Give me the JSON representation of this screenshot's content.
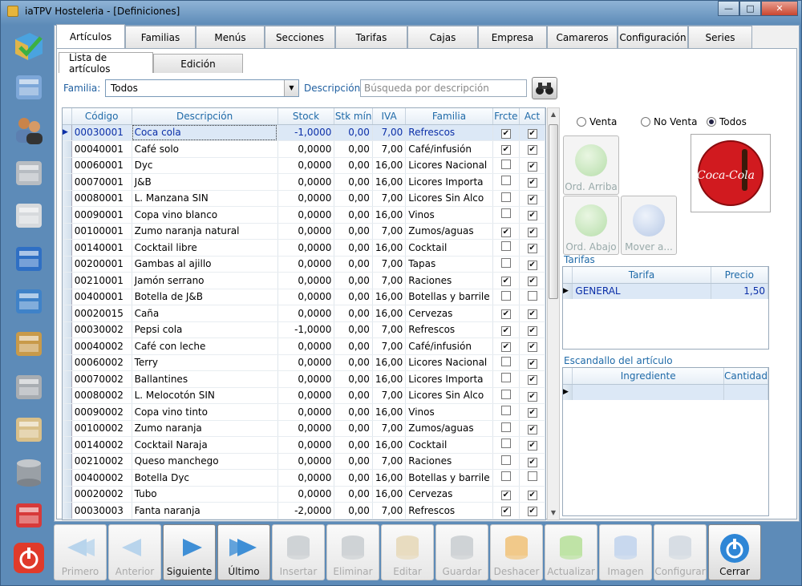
{
  "window": {
    "title": "iaTPV Hosteleria - [Definiciones]",
    "minimize": "—",
    "maximize": "□",
    "close": "✕"
  },
  "sidebar": [
    {
      "name": "sidebar-articulos",
      "icon": "box-check-icon"
    },
    {
      "name": "sidebar-ventas",
      "icon": "window-grid-icon"
    },
    {
      "name": "sidebar-usuarios",
      "icon": "users-icon"
    },
    {
      "name": "sidebar-caja",
      "icon": "cash-register-icon"
    },
    {
      "name": "sidebar-calculadora",
      "icon": "calculator-icon"
    },
    {
      "name": "sidebar-calendario",
      "icon": "calendar-icon"
    },
    {
      "name": "sidebar-informes",
      "icon": "edit-document-icon"
    },
    {
      "name": "sidebar-importar",
      "icon": "download-box-icon"
    },
    {
      "name": "sidebar-herramientas",
      "icon": "tools-icon"
    },
    {
      "name": "sidebar-documentos",
      "icon": "clipboard-icon"
    },
    {
      "name": "sidebar-base-datos",
      "icon": "database-icon"
    },
    {
      "name": "sidebar-ayuda",
      "icon": "help-icon"
    },
    {
      "name": "sidebar-salir",
      "icon": "power-icon"
    }
  ],
  "tabs": [
    "Artículos",
    "Familias",
    "Menús",
    "Secciones",
    "Tarifas",
    "Cajas",
    "Empresa",
    "Camareros",
    "Configuración",
    "Series"
  ],
  "subtabs": [
    "Lista de artículos",
    "Edición"
  ],
  "filters": {
    "familia_label": "Familia:",
    "familia_value": "Todos",
    "descripcion_label": "Descripción:",
    "search_placeholder": "Búsqueda por descripción"
  },
  "grid": {
    "columns": [
      "Código",
      "Descripción",
      "Stock",
      "Stk mín",
      "IVA",
      "Familia",
      "Frcte",
      "Act"
    ],
    "rows": [
      [
        "00030001",
        "Coca cola",
        "-1,0000",
        "0,00",
        "7,00",
        "Refrescos",
        true,
        true
      ],
      [
        "00040001",
        "Café solo",
        "0,0000",
        "0,00",
        "7,00",
        "Café/infusión",
        true,
        true
      ],
      [
        "00060001",
        "Dyc",
        "0,0000",
        "0,00",
        "16,00",
        "Licores Nacional",
        false,
        true
      ],
      [
        "00070001",
        "J&B",
        "0,0000",
        "0,00",
        "16,00",
        "Licores Importa",
        false,
        true
      ],
      [
        "00080001",
        "L. Manzana SIN",
        "0,0000",
        "0,00",
        "7,00",
        "Licores Sin Alco",
        false,
        true
      ],
      [
        "00090001",
        "Copa vino blanco",
        "0,0000",
        "0,00",
        "16,00",
        "Vinos",
        false,
        true
      ],
      [
        "00100001",
        "Zumo naranja natural",
        "0,0000",
        "0,00",
        "7,00",
        "Zumos/aguas",
        true,
        true
      ],
      [
        "00140001",
        "Cocktail libre",
        "0,0000",
        "0,00",
        "16,00",
        "Cocktail",
        false,
        true
      ],
      [
        "00200001",
        "Gambas al ajillo",
        "0,0000",
        "0,00",
        "7,00",
        "Tapas",
        false,
        true
      ],
      [
        "00210001",
        "Jamón serrano",
        "0,0000",
        "0,00",
        "7,00",
        "Raciones",
        true,
        true
      ],
      [
        "00400001",
        "Botella de J&B",
        "0,0000",
        "0,00",
        "16,00",
        "Botellas y barrile",
        false,
        false
      ],
      [
        "00020015",
        "Caña",
        "0,0000",
        "0,00",
        "16,00",
        "Cervezas",
        true,
        true
      ],
      [
        "00030002",
        "Pepsi cola",
        "-1,0000",
        "0,00",
        "7,00",
        "Refrescos",
        true,
        true
      ],
      [
        "00040002",
        "Café con leche",
        "0,0000",
        "0,00",
        "7,00",
        "Café/infusión",
        true,
        true
      ],
      [
        "00060002",
        "Terry",
        "0,0000",
        "0,00",
        "16,00",
        "Licores Nacional",
        false,
        true
      ],
      [
        "00070002",
        "Ballantines",
        "0,0000",
        "0,00",
        "16,00",
        "Licores Importa",
        false,
        true
      ],
      [
        "00080002",
        "L. Melocotón SIN",
        "0,0000",
        "0,00",
        "7,00",
        "Licores Sin Alco",
        false,
        true
      ],
      [
        "00090002",
        "Copa vino tinto",
        "0,0000",
        "0,00",
        "16,00",
        "Vinos",
        false,
        true
      ],
      [
        "00100002",
        "Zumo naranja",
        "0,0000",
        "0,00",
        "7,00",
        "Zumos/aguas",
        false,
        true
      ],
      [
        "00140002",
        "Cocktail Naraja",
        "0,0000",
        "0,00",
        "16,00",
        "Cocktail",
        false,
        true
      ],
      [
        "00210002",
        "Queso manchego",
        "0,0000",
        "0,00",
        "7,00",
        "Raciones",
        false,
        true
      ],
      [
        "00400002",
        "Botella Dyc",
        "0,0000",
        "0,00",
        "16,00",
        "Botellas y barrile",
        false,
        false
      ],
      [
        "00020002",
        "Tubo",
        "0,0000",
        "0,00",
        "16,00",
        "Cervezas",
        true,
        true
      ],
      [
        "00030003",
        "Fanta naranja",
        "-2,0000",
        "0,00",
        "7,00",
        "Refrescos",
        true,
        true
      ]
    ]
  },
  "radios": [
    "Venta",
    "No Venta",
    "Todos"
  ],
  "order_buttons": {
    "up": "Ord. Arriba",
    "down": "Ord. Abajo",
    "move": "Mover a..."
  },
  "logo_text": "Coca-Cola",
  "tarifas": {
    "title": "Tarifas",
    "columns": [
      "Tarifa",
      "Precio"
    ],
    "row": [
      "GENERAL",
      "1,50"
    ]
  },
  "escandallo": {
    "title": "Escandallo del artículo",
    "columns": [
      "Ingrediente",
      "Cantidad"
    ]
  },
  "toolbar": [
    {
      "label": "Primero",
      "icon": "first-arrow-icon",
      "enabled": false
    },
    {
      "label": "Anterior",
      "icon": "prev-arrow-icon",
      "enabled": false
    },
    {
      "label": "Siguiente",
      "icon": "next-arrow-icon",
      "enabled": true
    },
    {
      "label": "Último",
      "icon": "last-arrow-icon",
      "enabled": true
    },
    {
      "label": "Insertar",
      "icon": "db-add-icon",
      "enabled": false
    },
    {
      "label": "Eliminar",
      "icon": "db-remove-icon",
      "enabled": false
    },
    {
      "label": "Editar",
      "icon": "pencil-icon",
      "enabled": false
    },
    {
      "label": "Guardar",
      "icon": "db-save-icon",
      "enabled": false
    },
    {
      "label": "Deshacer",
      "icon": "undo-icon",
      "enabled": false
    },
    {
      "label": "Actualizar",
      "icon": "refresh-gear-icon",
      "enabled": false
    },
    {
      "label": "Imagen",
      "icon": "image-icon",
      "enabled": false
    },
    {
      "label": "Configurar",
      "icon": "config-icon",
      "enabled": false
    },
    {
      "label": "Cerrar",
      "icon": "power-close-icon",
      "enabled": true
    }
  ]
}
